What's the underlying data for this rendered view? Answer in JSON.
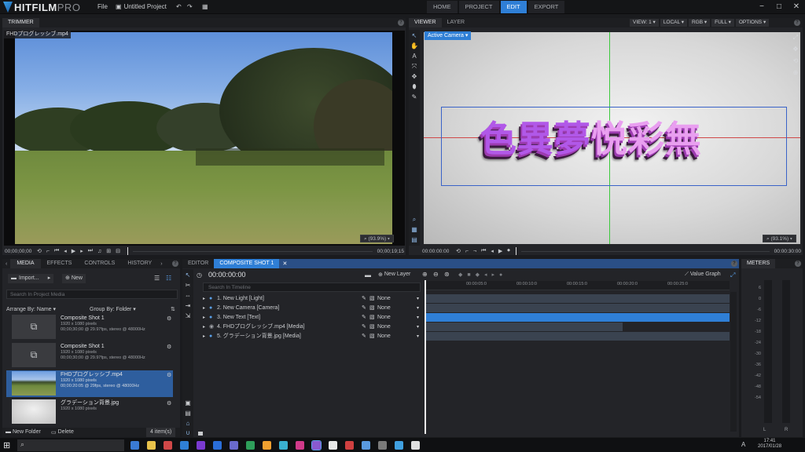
{
  "app": {
    "logo_main": "HITFILM",
    "logo_sub": "PRO",
    "file_menu": "File",
    "project_name": "Untitled Project"
  },
  "workspace_tabs": [
    {
      "label": "HOME"
    },
    {
      "label": "PROJECT"
    },
    {
      "label": "EDIT",
      "active": true
    },
    {
      "label": "EXPORT"
    }
  ],
  "trimmer": {
    "tab": "TRIMMER",
    "clip_label": "FHDプログレッシブ.mp4",
    "timecode_start": "00;00;00;00",
    "timecode_end": "00;00;19;15",
    "zoom": "(93.9%)"
  },
  "viewer": {
    "tabs": [
      "VIEWER",
      "LAYER"
    ],
    "camera_dropdown": "Active Camera",
    "options": [
      "VIEW: 1",
      "LOCAL",
      "RGB",
      "FULL",
      "OPTIONS"
    ],
    "text_part_a": "色異夢",
    "text_part_b": "悦彩無",
    "timecode_start": "00:00:00:00",
    "timecode_end": "00:00:30:00",
    "zoom": "(93.1%)"
  },
  "media": {
    "tabs": [
      "MEDIA",
      "EFFECTS",
      "CONTROLS",
      "HISTORY"
    ],
    "import_label": "Import...",
    "new_label": "New",
    "search_placeholder": "Search In Project Media",
    "arrange_label": "Arrange By: Name",
    "group_label": "Group By: Folder",
    "items": [
      {
        "name": "Composite Shot 1",
        "line1": "1920 x 1080 pixels",
        "line2": "00;00;30;00 @ 29.97fps, stereo @ 48000Hz"
      },
      {
        "name": "Composite Shot 1",
        "line1": "1920 x 1080 pixels",
        "line2": "00;00;30;00 @ 29.97fps, stereo @ 48000Hz"
      },
      {
        "name": "FHDプログレッシブ.mp4",
        "line1": "1920 x 1080 pixels",
        "line2": "00;00:20:05 @ 29fps, stereo @ 48000Hz"
      },
      {
        "name": "グラデーション背景.jpg",
        "line1": "1920 x 1080 pixels",
        "line2": ""
      }
    ],
    "new_folder_label": "New Folder",
    "delete_label": "Delete",
    "count_label": "4 item(s)"
  },
  "editor": {
    "tabs": [
      "EDITOR",
      "COMPOSITE SHOT 1"
    ],
    "timecode": "00:00:00:00",
    "new_layer_label": "New Layer",
    "value_graph_label": "Value Graph",
    "search_placeholder": "Search In Timeline",
    "ruler": [
      "00:00:05:0",
      "00:00:10:0",
      "00:00:15:0",
      "00:00:20:0",
      "00:00:25:0"
    ],
    "layers": [
      {
        "name": "1. New Light [Light]",
        "blend": "None"
      },
      {
        "name": "2. New Camera [Camera]",
        "blend": "None"
      },
      {
        "name": "3. New Text [Text]",
        "blend": "None"
      },
      {
        "name": "4. FHDプログレッシブ.mp4 [Media]",
        "blend": "None"
      },
      {
        "name": "5. グラデーション背景.jpg [Media]",
        "blend": "None"
      }
    ]
  },
  "meters": {
    "title": "METERS",
    "scale": [
      "6",
      "0",
      "-6",
      "-12",
      "-18",
      "-24",
      "-30",
      "-36",
      "-42",
      "-48",
      "-54"
    ],
    "channels": [
      "L",
      "R"
    ]
  },
  "taskbar": {
    "time": "17:41",
    "date": "2017/01/28"
  },
  "colors": {
    "accent": "#2f7fd6",
    "selected": "#2e5e9e",
    "bbox": "#3a63c8"
  }
}
